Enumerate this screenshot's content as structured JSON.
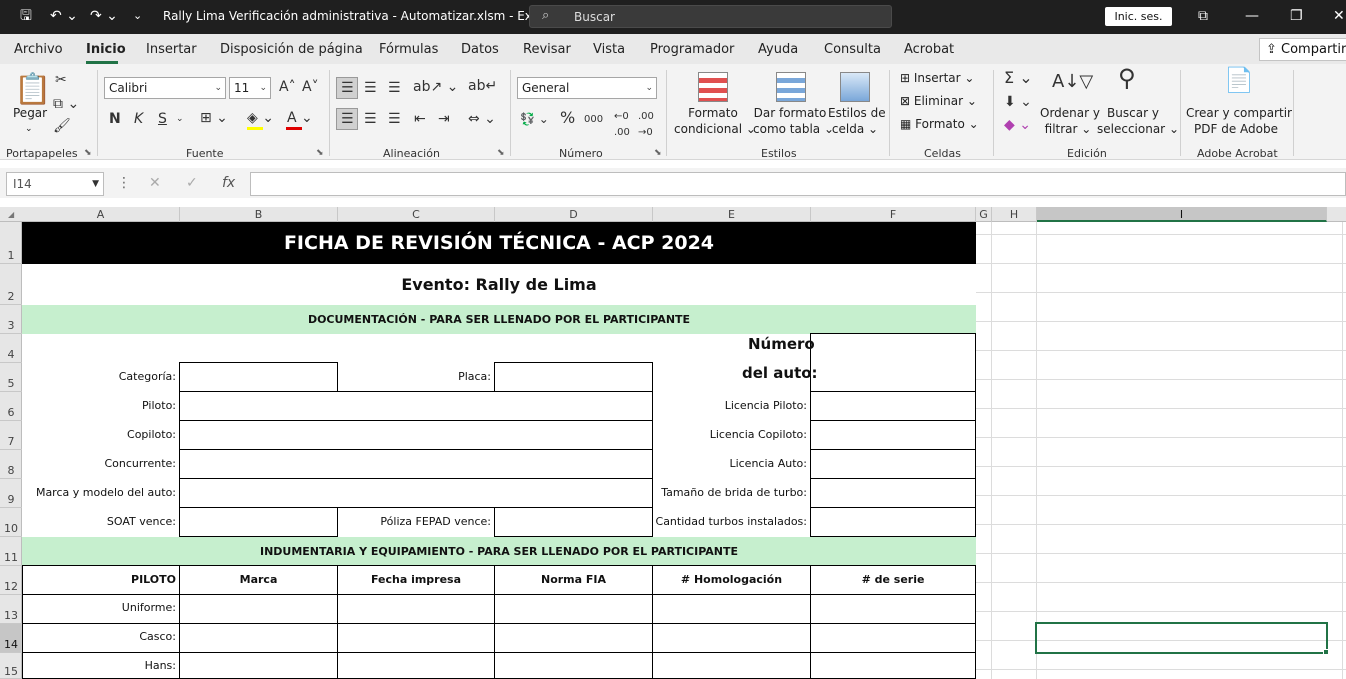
{
  "titlebar": {
    "title": "Rally Lima Verificación administrativa - Automatizar.xlsm  -  Excel",
    "search_placeholder": "Buscar",
    "signin": "Inic. ses."
  },
  "tabs": [
    "Archivo",
    "Inicio",
    "Insertar",
    "Disposición de página",
    "Fórmulas",
    "Datos",
    "Revisar",
    "Vista",
    "Programador",
    "Ayuda",
    "Consulta",
    "Acrobat"
  ],
  "share_label": "Compartir",
  "ribbon": {
    "groups": {
      "portapapeles": "Portapapeles",
      "fuente": "Fuente",
      "alineacion": "Alineación",
      "numero": "Número",
      "estilos": "Estilos",
      "celdas": "Celdas",
      "edicion": "Edición",
      "adobe": "Adobe Acrobat"
    },
    "pegar": "Pegar",
    "font_name": "Calibri",
    "font_size": "11",
    "bold": "N",
    "italic": "K",
    "underline": "S",
    "number_format": "General",
    "formato_condicional": [
      "Formato",
      "condicional"
    ],
    "dar_formato": [
      "Dar formato",
      "como tabla"
    ],
    "estilos_celda": [
      "Estilos de",
      "celda"
    ],
    "insertar": "Insertar",
    "eliminar": "Eliminar",
    "formato": "Formato",
    "ordenar": [
      "Ordenar y",
      "filtrar"
    ],
    "buscar": [
      "Buscar y",
      "seleccionar"
    ],
    "crear_pdf": [
      "Crear y compartir",
      "PDF de Adobe"
    ]
  },
  "namebox": "I14",
  "columns": [
    "A",
    "B",
    "C",
    "D",
    "E",
    "F",
    "G",
    "H",
    "I"
  ],
  "rows": [
    "1",
    "2",
    "3",
    "4",
    "5",
    "6",
    "7",
    "8",
    "9",
    "10",
    "11",
    "12",
    "13",
    "14",
    "15"
  ],
  "sheet": {
    "title": "FICHA DE REVISIÓN TÉCNICA - ACP 2024",
    "event": "Evento: Rally de Lima",
    "section_doc": "DOCUMENTACIÓN - PARA SER LLENADO POR EL PARTICIPANTE",
    "numero": "Número",
    "del_auto": "del auto:",
    "categoria": "Categoría:",
    "placa": "Placa:",
    "piloto": "Piloto:",
    "licencia_piloto": "Licencia Piloto:",
    "copiloto": "Copiloto:",
    "licencia_copiloto": "Licencia Copiloto:",
    "concurrente": "Concurrente:",
    "licencia_auto": "Licencia Auto:",
    "marca_modelo": "Marca y modelo del auto:",
    "brida": "Tamaño de brida de turbo:",
    "soat": "SOAT vence:",
    "poliza": "Póliza FEPAD vence:",
    "turbos": "Cantidad turbos instalados:",
    "section_equip": "INDUMENTARIA Y EQUIPAMIENTO - PARA SER LLENADO POR EL PARTICIPANTE",
    "equip_headers": [
      "PILOTO",
      "Marca",
      "Fecha impresa",
      "Norma FIA",
      "# Homologación",
      "# de serie"
    ],
    "equip_rows": [
      "Uniforme:",
      "Casco:",
      "Hans:"
    ]
  },
  "colors": {
    "accent": "#217346",
    "section_fill": "#c6efce",
    "title_fill": "#000000"
  }
}
